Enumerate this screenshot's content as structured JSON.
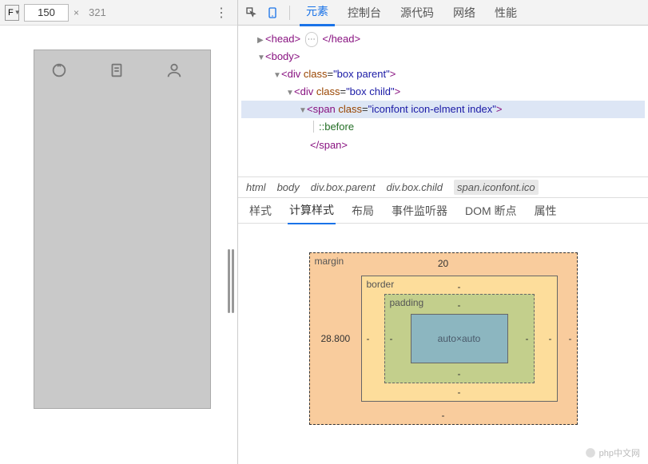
{
  "device": {
    "selector": "F",
    "width": "150",
    "height": "321"
  },
  "tabs": {
    "elements": "元素",
    "console": "控制台",
    "sources": "源代码",
    "network": "网络",
    "performance": "性能"
  },
  "dom": {
    "head_open": "<head>",
    "head_close": "</head>",
    "head_ellipsis": "⋯",
    "body_open": "<body>",
    "div1_open": "<div class=",
    "div1_val": "\"box parent\"",
    "div1_close": ">",
    "div2_open": "<div class=",
    "div2_val": "\"box child\"",
    "div2_close": ">",
    "span_open": "<span class=",
    "span_val": "\"iconfont icon-elment index\"",
    "span_close": ">",
    "pseudo": "::before",
    "span_end": "</span>"
  },
  "breadcrumbs": [
    "html",
    "body",
    "div.box.parent",
    "div.box.child",
    "span.iconfont.ico"
  ],
  "style_tabs": {
    "styles": "样式",
    "computed": "计算样式",
    "layout": "布局",
    "listeners": "事件监听器",
    "dom_bp": "DOM 断点",
    "props": "属性"
  },
  "box_model": {
    "margin_label": "margin",
    "border_label": "border",
    "padding_label": "padding",
    "margin_top": "20",
    "margin_right": "-",
    "margin_bottom": "-",
    "margin_left": "28.800",
    "border_top": "-",
    "border_right": "-",
    "border_bottom": "-",
    "border_left": "-",
    "padding_top": "-",
    "padding_right": "-",
    "padding_bottom": "-",
    "padding_left": "-",
    "content": "auto×auto"
  },
  "watermark": "php中文网"
}
